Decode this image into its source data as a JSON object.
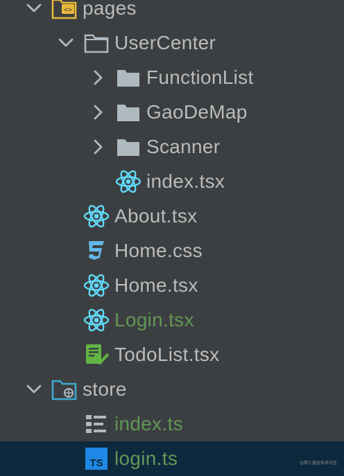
{
  "tree": {
    "pages": {
      "label": "pages",
      "icon": "web-folder-icon"
    },
    "usercenter": {
      "label": "UserCenter",
      "icon": "folder-icon"
    },
    "functionlist": {
      "label": "FunctionList",
      "icon": "folder-icon"
    },
    "gaodemap": {
      "label": "GaoDeMap",
      "icon": "folder-icon"
    },
    "scanner": {
      "label": "Scanner",
      "icon": "folder-icon"
    },
    "uc_index": {
      "label": "index.tsx",
      "icon": "react-icon"
    },
    "about": {
      "label": "About.tsx",
      "icon": "react-icon"
    },
    "home_css": {
      "label": "Home.css",
      "icon": "css-icon"
    },
    "home_tsx": {
      "label": "Home.tsx",
      "icon": "react-icon"
    },
    "login_tsx": {
      "label": "Login.tsx",
      "icon": "react-icon",
      "status": "added"
    },
    "todolist": {
      "label": "TodoList.tsx",
      "icon": "todo-list-icon"
    },
    "store": {
      "label": "store",
      "icon": "store-folder-icon"
    },
    "store_index": {
      "label": "index.ts",
      "icon": "structure-icon",
      "status": "added"
    },
    "login_ts": {
      "label": "login.ts",
      "icon": "typescript-icon",
      "status": "added",
      "selected": true
    }
  },
  "watermark": "@稀土掘金技术社区",
  "colors": {
    "background": "#3c3f41",
    "selected_row": "#0d293e",
    "text": "#bbbbbb",
    "added_text": "#629755",
    "react": "#61dafb",
    "folder": "#aeb9c0",
    "typescript": "#1e88e5"
  }
}
